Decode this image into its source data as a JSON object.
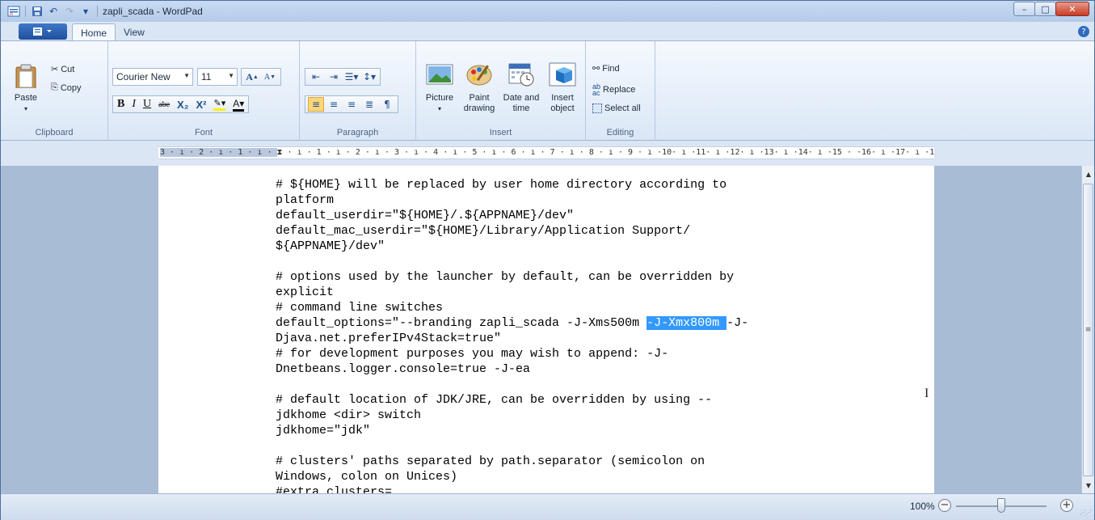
{
  "window": {
    "title": "zapli_scada - WordPad",
    "controls": {
      "minimize": "–",
      "maximize": "□",
      "close": "✕"
    }
  },
  "quick_access": {
    "save_icon": "💾",
    "undo_icon": "↶",
    "redo_icon": "↷",
    "dropdown": "▾"
  },
  "tabs": [
    {
      "label": "Home",
      "active": true
    },
    {
      "label": "View",
      "active": false
    }
  ],
  "ribbon": {
    "clipboard": {
      "label": "Clipboard",
      "paste": "Paste",
      "cut": "Cut",
      "copy": "Copy"
    },
    "font": {
      "label": "Font",
      "family": "Courier New",
      "size": "11",
      "bold": "B",
      "italic": "I",
      "underline": "U",
      "strike": "abe",
      "subscript": "X₂",
      "superscript": "X²"
    },
    "paragraph": {
      "label": "Paragraph"
    },
    "insert": {
      "label": "Insert",
      "picture": "Picture",
      "paint_drawing": "Paint drawing",
      "date_time": "Date and time",
      "insert_object": "Insert object"
    },
    "editing": {
      "label": "Editing",
      "find": "Find",
      "replace": "Replace",
      "select_all": "Select all"
    }
  },
  "ruler": {
    "left_numbers": "3 · ı · 2 · ı · 1 · ı · ",
    "right_numbers": " · ı · 1 · ı · 2 · ı · 3 · ı · 4 · ı · 5 · ı · 6 · ı · 7 · ı · 8 · ı · 9 · ı ·10· ı ·11· ı ·12· ı ·13· ı ·14· ı ·15 · ·16· ı ·17· ı ·18·"
  },
  "document": {
    "lines": [
      "# ${HOME} will be replaced by user home directory according to",
      "platform",
      "default_userdir=\"${HOME}/.${APPNAME}/dev\"",
      "default_mac_userdir=\"${HOME}/Library/Application Support/",
      "${APPNAME}/dev\"",
      "",
      "# options used by the launcher by default, can be overridden by",
      "explicit",
      "# command line switches"
    ],
    "options_line_before": "default_options=\"--branding zapli_scada -J-Xms500m ",
    "options_line_selected": "-J-Xmx800m ",
    "options_line_after": "-J-",
    "lines_after": [
      "Djava.net.preferIPv4Stack=true\"",
      "# for development purposes you may wish to append: -J-",
      "Dnetbeans.logger.console=true -J-ea",
      "",
      "# default location of JDK/JRE, can be overridden by using --",
      "jdkhome <dir> switch",
      "jdkhome=\"jdk\"",
      "",
      "# clusters' paths separated by path.separator (semicolon on",
      "Windows, colon on Unices)",
      "#extra_clusters="
    ]
  },
  "status": {
    "zoom": "100%",
    "zoom_level_percent": 100
  },
  "colors": {
    "selection": "#3399ff",
    "ribbon_bg": "#dbe7f6",
    "title_bg": "#c9dbf2"
  }
}
